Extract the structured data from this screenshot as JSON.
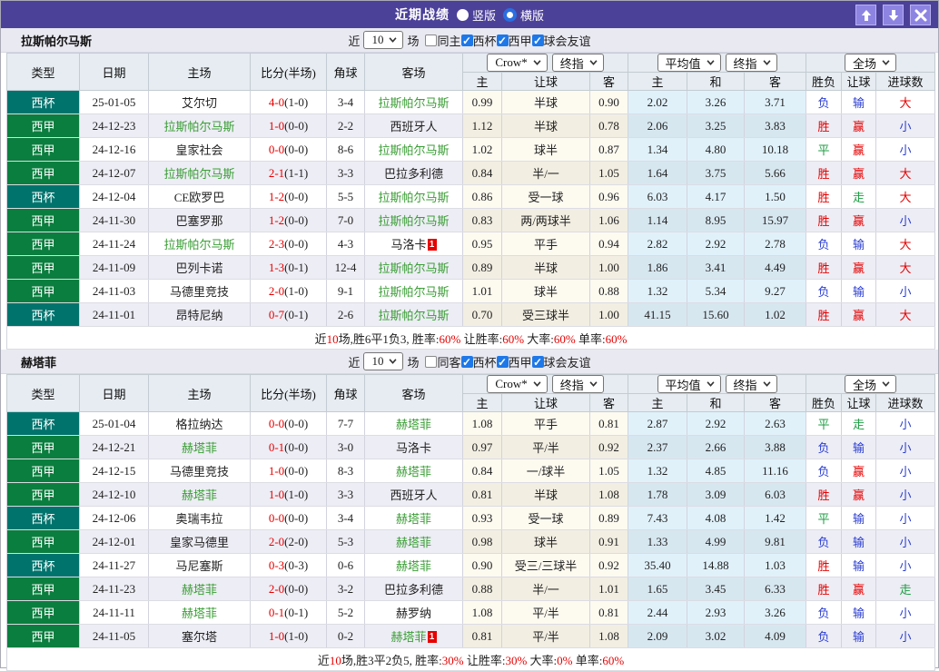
{
  "titlebar": {
    "title": "近期战绩",
    "radio_vertical": "竖版",
    "radio_horizontal": "横版"
  },
  "colors": {
    "accent_purple": "#4c4199",
    "cup_teal": "#00736d",
    "liga_green": "#0a7e3e",
    "win_red": "#e60000",
    "lose_blue": "#2b3ed2",
    "draw_green": "#1d9e43",
    "team_green": "#3a9e35"
  },
  "table_header": {
    "type": "类型",
    "date": "日期",
    "home": "主场",
    "score": "比分(半场)",
    "corner": "角球",
    "away": "客场",
    "group1_selects": [
      "Crow*",
      "终指"
    ],
    "group1_cols": [
      "主",
      "让球",
      "客"
    ],
    "group2_selects": [
      "平均值",
      "终指"
    ],
    "group2_cols": [
      "主",
      "和",
      "客"
    ],
    "group3_selects": [
      "全场"
    ],
    "group3_cols": [
      "胜负",
      "让球",
      "进球数"
    ]
  },
  "filter_labels": {
    "near": "近",
    "count": "10",
    "games": "场",
    "leagues": [
      "西杯",
      "西甲",
      "球会友谊"
    ]
  },
  "sections": [
    {
      "team": "拉斯帕尔马斯",
      "same_label": "同主",
      "rows": [
        {
          "league": "西杯",
          "type": "cup",
          "date": "25-01-05",
          "home": {
            "t": "艾尔切"
          },
          "score": {
            "m": "4-0",
            "h": "(1-0)"
          },
          "corner": "3-4",
          "away": {
            "t": "拉斯帕尔马斯",
            "hl": true
          },
          "crow": [
            "0.99",
            "半球",
            "0.90"
          ],
          "avg": [
            "2.02",
            "3.26",
            "3.71"
          ],
          "res": [
            [
              "负",
              "blue"
            ],
            [
              "输",
              "blue"
            ],
            [
              "大",
              "red"
            ]
          ]
        },
        {
          "league": "西甲",
          "type": "liga",
          "date": "24-12-23",
          "home": {
            "t": "拉斯帕尔马斯",
            "hl": true
          },
          "score": {
            "m": "1-0",
            "h": "(0-0)"
          },
          "corner": "2-2",
          "away": {
            "t": "西班牙人"
          },
          "crow": [
            "1.12",
            "半球",
            "0.78"
          ],
          "avg": [
            "2.06",
            "3.25",
            "3.83"
          ],
          "res": [
            [
              "胜",
              "red"
            ],
            [
              "赢",
              "red"
            ],
            [
              "小",
              "blue"
            ]
          ]
        },
        {
          "league": "西甲",
          "type": "liga",
          "date": "24-12-16",
          "home": {
            "t": "皇家社会"
          },
          "score": {
            "m": "0-0",
            "h": "(0-0)"
          },
          "corner": "8-6",
          "away": {
            "t": "拉斯帕尔马斯",
            "hl": true
          },
          "crow": [
            "1.02",
            "球半",
            "0.87"
          ],
          "avg": [
            "1.34",
            "4.80",
            "10.18"
          ],
          "res": [
            [
              "平",
              "green"
            ],
            [
              "赢",
              "red"
            ],
            [
              "小",
              "blue"
            ]
          ]
        },
        {
          "league": "西甲",
          "type": "liga",
          "date": "24-12-07",
          "home": {
            "t": "拉斯帕尔马斯",
            "hl": true
          },
          "score": {
            "m": "2-1",
            "h": "(1-1)"
          },
          "corner": "3-3",
          "away": {
            "t": "巴拉多利德"
          },
          "crow": [
            "0.84",
            "半/一",
            "1.05"
          ],
          "avg": [
            "1.64",
            "3.75",
            "5.66"
          ],
          "res": [
            [
              "胜",
              "red"
            ],
            [
              "赢",
              "red"
            ],
            [
              "大",
              "red"
            ]
          ]
        },
        {
          "league": "西杯",
          "type": "cup",
          "date": "24-12-04",
          "home": {
            "t": "CE欧罗巴"
          },
          "score": {
            "m": "1-2",
            "h": "(0-0)"
          },
          "corner": "5-5",
          "away": {
            "t": "拉斯帕尔马斯",
            "hl": true
          },
          "crow": [
            "0.86",
            "受一球",
            "0.96"
          ],
          "avg": [
            "6.03",
            "4.17",
            "1.50"
          ],
          "res": [
            [
              "胜",
              "red"
            ],
            [
              "走",
              "green"
            ],
            [
              "大",
              "red"
            ]
          ]
        },
        {
          "league": "西甲",
          "type": "liga",
          "date": "24-11-30",
          "home": {
            "t": "巴塞罗那"
          },
          "score": {
            "m": "1-2",
            "h": "(0-0)"
          },
          "corner": "7-0",
          "away": {
            "t": "拉斯帕尔马斯",
            "hl": true
          },
          "crow": [
            "0.83",
            "两/两球半",
            "1.06"
          ],
          "avg": [
            "1.14",
            "8.95",
            "15.97"
          ],
          "res": [
            [
              "胜",
              "red"
            ],
            [
              "赢",
              "red"
            ],
            [
              "小",
              "blue"
            ]
          ]
        },
        {
          "league": "西甲",
          "type": "liga",
          "date": "24-11-24",
          "home": {
            "t": "拉斯帕尔马斯",
            "hl": true
          },
          "score": {
            "m": "2-3",
            "h": "(0-0)"
          },
          "corner": "4-3",
          "away": {
            "t": "马洛卡",
            "badge": "1"
          },
          "crow": [
            "0.95",
            "平手",
            "0.94"
          ],
          "avg": [
            "2.82",
            "2.92",
            "2.78"
          ],
          "res": [
            [
              "负",
              "blue"
            ],
            [
              "输",
              "blue"
            ],
            [
              "大",
              "red"
            ]
          ]
        },
        {
          "league": "西甲",
          "type": "liga",
          "date": "24-11-09",
          "home": {
            "t": "巴列卡诺"
          },
          "score": {
            "m": "1-3",
            "h": "(0-1)"
          },
          "corner": "12-4",
          "away": {
            "t": "拉斯帕尔马斯",
            "hl": true
          },
          "crow": [
            "0.89",
            "半球",
            "1.00"
          ],
          "avg": [
            "1.86",
            "3.41",
            "4.49"
          ],
          "res": [
            [
              "胜",
              "red"
            ],
            [
              "赢",
              "red"
            ],
            [
              "大",
              "red"
            ]
          ]
        },
        {
          "league": "西甲",
          "type": "liga",
          "date": "24-11-03",
          "home": {
            "t": "马德里竞技"
          },
          "score": {
            "m": "2-0",
            "h": "(1-0)"
          },
          "corner": "9-1",
          "away": {
            "t": "拉斯帕尔马斯",
            "hl": true
          },
          "crow": [
            "1.01",
            "球半",
            "0.88"
          ],
          "avg": [
            "1.32",
            "5.34",
            "9.27"
          ],
          "res": [
            [
              "负",
              "blue"
            ],
            [
              "输",
              "blue"
            ],
            [
              "小",
              "blue"
            ]
          ]
        },
        {
          "league": "西杯",
          "type": "cup",
          "date": "24-11-01",
          "home": {
            "t": "昂特尼纳"
          },
          "score": {
            "m": "0-7",
            "h": "(0-1)"
          },
          "corner": "2-6",
          "away": {
            "t": "拉斯帕尔马斯",
            "hl": true
          },
          "crow": [
            "0.70",
            "受三球半",
            "1.00"
          ],
          "avg": [
            "41.15",
            "15.60",
            "1.02"
          ],
          "res": [
            [
              "胜",
              "red"
            ],
            [
              "赢",
              "red"
            ],
            [
              "大",
              "red"
            ]
          ]
        }
      ],
      "footer": [
        {
          "t": "近"
        },
        {
          "t": "10",
          "red": true
        },
        {
          "t": "场,胜6平1负3, 胜率:"
        },
        {
          "t": "60%",
          "red": true
        },
        {
          "t": " 让胜率:"
        },
        {
          "t": "60%",
          "red": true
        },
        {
          "t": " 大率:"
        },
        {
          "t": "60%",
          "red": true
        },
        {
          "t": " 单率:"
        },
        {
          "t": "60%",
          "red": true
        }
      ]
    },
    {
      "team": "赫塔菲",
      "same_label": "同客",
      "rows": [
        {
          "league": "西杯",
          "type": "cup",
          "date": "25-01-04",
          "home": {
            "t": "格拉纳达"
          },
          "score": {
            "m": "0-0",
            "h": "(0-0)"
          },
          "corner": "7-7",
          "away": {
            "t": "赫塔菲",
            "hl": true
          },
          "crow": [
            "1.08",
            "平手",
            "0.81"
          ],
          "avg": [
            "2.87",
            "2.92",
            "2.63"
          ],
          "res": [
            [
              "平",
              "green"
            ],
            [
              "走",
              "green"
            ],
            [
              "小",
              "blue"
            ]
          ]
        },
        {
          "league": "西甲",
          "type": "liga",
          "date": "24-12-21",
          "home": {
            "t": "赫塔菲",
            "hl": true
          },
          "score": {
            "m": "0-1",
            "h": "(0-0)"
          },
          "corner": "3-0",
          "away": {
            "t": "马洛卡"
          },
          "crow": [
            "0.97",
            "平/半",
            "0.92"
          ],
          "avg": [
            "2.37",
            "2.66",
            "3.88"
          ],
          "res": [
            [
              "负",
              "blue"
            ],
            [
              "输",
              "blue"
            ],
            [
              "小",
              "blue"
            ]
          ]
        },
        {
          "league": "西甲",
          "type": "liga",
          "date": "24-12-15",
          "home": {
            "t": "马德里竞技"
          },
          "score": {
            "m": "1-0",
            "h": "(0-0)"
          },
          "corner": "8-3",
          "away": {
            "t": "赫塔菲",
            "hl": true
          },
          "crow": [
            "0.84",
            "一/球半",
            "1.05"
          ],
          "avg": [
            "1.32",
            "4.85",
            "11.16"
          ],
          "res": [
            [
              "负",
              "blue"
            ],
            [
              "赢",
              "red"
            ],
            [
              "小",
              "blue"
            ]
          ]
        },
        {
          "league": "西甲",
          "type": "liga",
          "date": "24-12-10",
          "home": {
            "t": "赫塔菲",
            "hl": true
          },
          "score": {
            "m": "1-0",
            "h": "(1-0)"
          },
          "corner": "3-3",
          "away": {
            "t": "西班牙人"
          },
          "crow": [
            "0.81",
            "半球",
            "1.08"
          ],
          "avg": [
            "1.78",
            "3.09",
            "6.03"
          ],
          "res": [
            [
              "胜",
              "red"
            ],
            [
              "赢",
              "red"
            ],
            [
              "小",
              "blue"
            ]
          ]
        },
        {
          "league": "西杯",
          "type": "cup",
          "date": "24-12-06",
          "home": {
            "t": "奥瑞韦拉"
          },
          "score": {
            "m": "0-0",
            "h": "(0-0)"
          },
          "corner": "3-4",
          "away": {
            "t": "赫塔菲",
            "hl": true
          },
          "crow": [
            "0.93",
            "受一球",
            "0.89"
          ],
          "avg": [
            "7.43",
            "4.08",
            "1.42"
          ],
          "res": [
            [
              "平",
              "green"
            ],
            [
              "输",
              "blue"
            ],
            [
              "小",
              "blue"
            ]
          ]
        },
        {
          "league": "西甲",
          "type": "liga",
          "date": "24-12-01",
          "home": {
            "t": "皇家马德里"
          },
          "score": {
            "m": "2-0",
            "h": "(2-0)"
          },
          "corner": "5-3",
          "away": {
            "t": "赫塔菲",
            "hl": true
          },
          "crow": [
            "0.98",
            "球半",
            "0.91"
          ],
          "avg": [
            "1.33",
            "4.99",
            "9.81"
          ],
          "res": [
            [
              "负",
              "blue"
            ],
            [
              "输",
              "blue"
            ],
            [
              "小",
              "blue"
            ]
          ]
        },
        {
          "league": "西杯",
          "type": "cup",
          "date": "24-11-27",
          "home": {
            "t": "马尼塞斯"
          },
          "score": {
            "m": "0-3",
            "h": "(0-3)"
          },
          "corner": "0-6",
          "away": {
            "t": "赫塔菲",
            "hl": true
          },
          "crow": [
            "0.90",
            "受三/三球半",
            "0.92"
          ],
          "avg": [
            "35.40",
            "14.88",
            "1.03"
          ],
          "res": [
            [
              "胜",
              "red"
            ],
            [
              "输",
              "blue"
            ],
            [
              "小",
              "blue"
            ]
          ]
        },
        {
          "league": "西甲",
          "type": "liga",
          "date": "24-11-23",
          "home": {
            "t": "赫塔菲",
            "hl": true
          },
          "score": {
            "m": "2-0",
            "h": "(0-0)"
          },
          "corner": "3-2",
          "away": {
            "t": "巴拉多利德"
          },
          "crow": [
            "0.88",
            "半/一",
            "1.01"
          ],
          "avg": [
            "1.65",
            "3.45",
            "6.33"
          ],
          "res": [
            [
              "胜",
              "red"
            ],
            [
              "赢",
              "red"
            ],
            [
              "走",
              "green"
            ]
          ]
        },
        {
          "league": "西甲",
          "type": "liga",
          "date": "24-11-11",
          "home": {
            "t": "赫塔菲",
            "hl": true
          },
          "score": {
            "m": "0-1",
            "h": "(0-1)"
          },
          "corner": "5-2",
          "away": {
            "t": "赫罗纳"
          },
          "crow": [
            "1.08",
            "平/半",
            "0.81"
          ],
          "avg": [
            "2.44",
            "2.93",
            "3.26"
          ],
          "res": [
            [
              "负",
              "blue"
            ],
            [
              "输",
              "blue"
            ],
            [
              "小",
              "blue"
            ]
          ]
        },
        {
          "league": "西甲",
          "type": "liga",
          "date": "24-11-05",
          "home": {
            "t": "塞尔塔"
          },
          "score": {
            "m": "1-0",
            "h": "(1-0)"
          },
          "corner": "0-2",
          "away": {
            "t": "赫塔菲",
            "hl": true,
            "badge": "1"
          },
          "crow": [
            "0.81",
            "平/半",
            "1.08"
          ],
          "avg": [
            "2.09",
            "3.02",
            "4.09"
          ],
          "res": [
            [
              "负",
              "blue"
            ],
            [
              "输",
              "blue"
            ],
            [
              "小",
              "blue"
            ]
          ]
        }
      ],
      "footer": [
        {
          "t": "近"
        },
        {
          "t": "10",
          "red": true
        },
        {
          "t": "场,胜3平2负5, 胜率:"
        },
        {
          "t": "30%",
          "red": true
        },
        {
          "t": " 让胜率:"
        },
        {
          "t": "30%",
          "red": true
        },
        {
          "t": " 大率:"
        },
        {
          "t": "0%",
          "red": true
        },
        {
          "t": " 单率:"
        },
        {
          "t": "60%",
          "red": true
        }
      ]
    }
  ]
}
